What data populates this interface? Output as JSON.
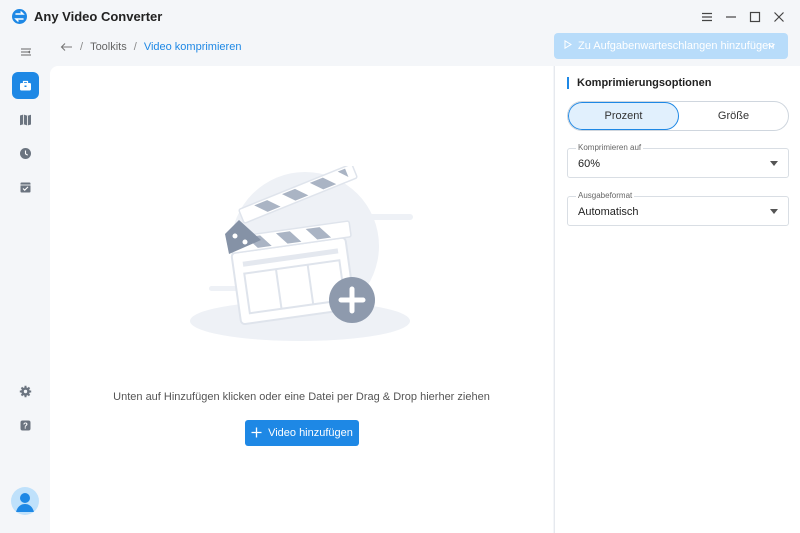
{
  "app": {
    "title": "Any Video Converter",
    "logo_icon": "app-logo-icon"
  },
  "window_controls": {
    "menu_icon": "menu-icon",
    "minimize_icon": "minimize-icon",
    "maximize_icon": "maximize-icon",
    "close_icon": "close-icon"
  },
  "sidebar": {
    "collapse_icon": "sidebar-collapse-icon",
    "items": [
      {
        "name": "toolkits",
        "icon": "briefcase-icon",
        "active": true
      },
      {
        "name": "library",
        "icon": "map-icon",
        "active": false
      },
      {
        "name": "history",
        "icon": "clock-icon",
        "active": false
      },
      {
        "name": "tasks",
        "icon": "checklist-icon",
        "active": false
      }
    ],
    "settings_icon": "gear-icon",
    "help_icon": "help-icon",
    "avatar_icon": "user-avatar-icon"
  },
  "breadcrumb": {
    "back_icon": "arrow-left-icon",
    "separator": "/",
    "items": [
      "Toolkits",
      "Video komprimieren"
    ]
  },
  "toolbar": {
    "queue_label": "Zu Aufgabenwarteschlangen hinzufügen"
  },
  "main": {
    "illustration": "clapperboard-add-icon",
    "hint": "Unten auf Hinzufügen klicken oder eine Datei per Drag & Drop hierher ziehen",
    "add_label": "Video hinzufügen"
  },
  "options": {
    "title": "Komprimierungsoptionen",
    "mode_tabs": [
      {
        "label": "Prozent",
        "active": true
      },
      {
        "label": "Größe",
        "active": false
      }
    ],
    "compress": {
      "label": "Komprimieren auf",
      "value": "60%"
    },
    "format": {
      "label": "Ausgabeformat",
      "value": "Automatisch"
    }
  },
  "colors": {
    "accent": "#1e88e5",
    "accent_light": "#e1f0fd",
    "disabled_button": "#b8dcfa"
  }
}
